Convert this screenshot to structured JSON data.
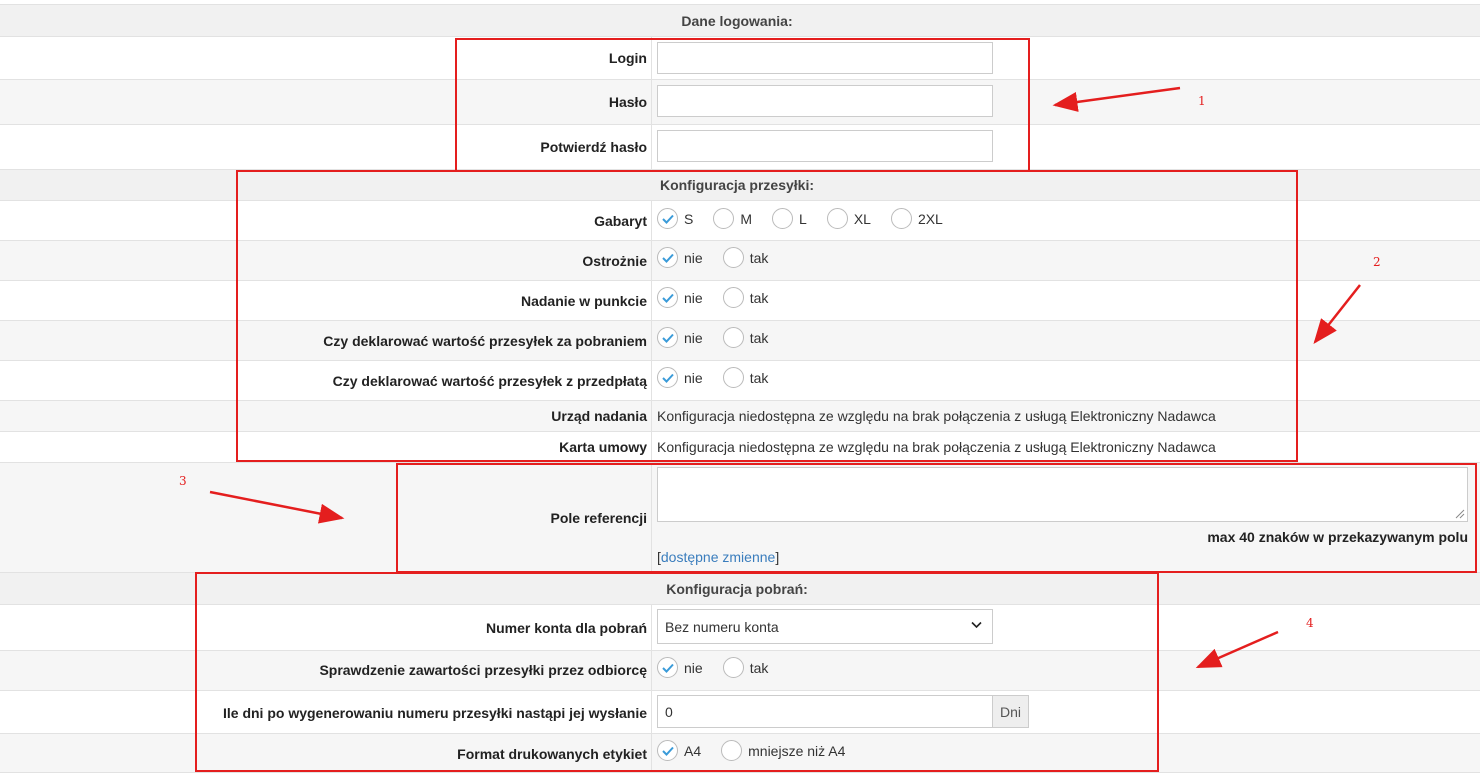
{
  "sections": {
    "login_title": "Dane logowania:",
    "shipping_title": "Konfiguracja przesyłki:",
    "cod_title": "Konfiguracja pobrań:"
  },
  "login": {
    "login_label": "Login",
    "password_label": "Hasło",
    "confirm_label": "Potwierdź hasło",
    "login_value": "",
    "password_value": "",
    "confirm_value": ""
  },
  "shipping": {
    "size_label": "Gabaryt",
    "size_options": [
      "S",
      "M",
      "L",
      "XL",
      "2XL"
    ],
    "size_selected": "S",
    "fragile_label": "Ostrożnie",
    "point_label": "Nadanie w punkcie",
    "declare_cod_label": "Czy deklarować wartość przesyłek za pobraniem",
    "declare_prepaid_label": "Czy deklarować wartość przesyłek z przedpłatą",
    "office_label": "Urząd nadania",
    "contract_label": "Karta umowy",
    "unavailable_text": "Konfiguracja niedostępna ze względu na brak połączenia z usługą Elektroniczny Nadawca",
    "no": "nie",
    "yes": "tak"
  },
  "reference": {
    "label": "Pole referencji",
    "value": "",
    "hint": "max 40 znaków w przekazywanym polu",
    "link_open": "[",
    "link_text": "dostępne zmienne",
    "link_close": "]"
  },
  "cod": {
    "account_label": "Numer konta dla pobrań",
    "account_selected": "Bez numeru konta",
    "inspection_label": "Sprawdzenie zawartości przesyłki przez odbiorcę",
    "days_label": "Ile dni po wygenerowaniu numeru przesyłki nastąpi jej wysłanie",
    "days_value": "0",
    "days_unit": "Dni",
    "format_label": "Format drukowanych etykiet",
    "format_a4": "A4",
    "format_smaller": "mniejsze niż A4"
  },
  "annotations": [
    "1",
    "2",
    "3",
    "4"
  ],
  "colors": {
    "accent_check": "#3a9bd9",
    "annotation_red": "#e41e1e",
    "link": "#3a7dbd"
  }
}
